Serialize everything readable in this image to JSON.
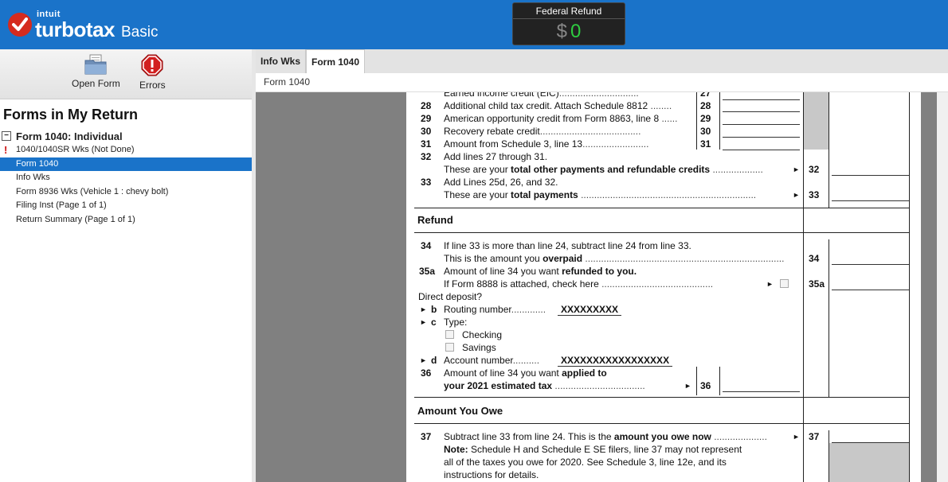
{
  "header": {
    "brand_small": "intuit",
    "brand": "turbotax",
    "edition": "Basic",
    "refund_label": "Federal Refund",
    "refund_currency": "$",
    "refund_value": "0"
  },
  "toolbar": {
    "open_form": "Open Form",
    "errors": "Errors"
  },
  "sidebar": {
    "title": "Forms in My Return",
    "root": "Form 1040:  Individual",
    "items": [
      {
        "label": "1040/1040SR Wks (Not Done)",
        "warn": "!"
      },
      {
        "label": "Form 1040"
      },
      {
        "label": "Info Wks"
      },
      {
        "label": "Form 8936 Wks (Vehicle 1 : chevy bolt)"
      },
      {
        "label": "Filing Inst (Page 1 of 1)"
      },
      {
        "label": "Return Summary (Page 1 of 1)"
      }
    ]
  },
  "tabs": [
    "Info Wks",
    "Form 1040"
  ],
  "breadcrumb": "Form 1040",
  "form": {
    "l27": {
      "text": "Earned income credit (EIC)",
      "box": "27"
    },
    "l28": {
      "num": "28",
      "text": "Additional child tax credit. Attach Schedule 8812",
      "box": "28"
    },
    "l29": {
      "num": "29",
      "text": "American opportunity credit from Form 8863, line 8",
      "box": "29"
    },
    "l30": {
      "num": "30",
      "text": "Recovery rebate credit",
      "box": "30"
    },
    "l31": {
      "num": "31",
      "text": "Amount from Schedule 3, line 13",
      "box": "31"
    },
    "l32": {
      "num": "32",
      "text1": "Add lines 27 through 31.",
      "text2a": "These are your ",
      "text2b": "total other payments and refundable credits",
      "box": "32"
    },
    "l33": {
      "num": "33",
      "text1": "Add Lines 25d, 26, and 32.",
      "text2a": "These are your ",
      "text2b": "total payments",
      "box": "33"
    },
    "refund_title": "Refund",
    "l34": {
      "num": "34",
      "text1": "If line 33 is more than line 24, subtract line 24 from line 33.",
      "text2a": "This is the amount you ",
      "text2b": "overpaid",
      "box": "34"
    },
    "l35a": {
      "num": "35a",
      "text1a": "Amount of line 34 you want ",
      "text1b": "refunded to you.",
      "text2": "If Form 8888 is attached, check here",
      "box": "35a"
    },
    "direct_deposit": "Direct deposit?",
    "lb": {
      "letter": "b",
      "text": "Routing number",
      "value": "XXXXXXXXX"
    },
    "lc": {
      "letter": "c",
      "text": "Type:",
      "opt1": "Checking",
      "opt2": "Savings"
    },
    "ld": {
      "letter": "d",
      "text": "Account number",
      "value": "XXXXXXXXXXXXXXXXX"
    },
    "l36": {
      "num": "36",
      "text1a": "Amount of line 34 you want ",
      "text1b": "applied to",
      "text2": "your 2021 estimated tax",
      "box": "36"
    },
    "owe_title": "Amount You Owe",
    "l37": {
      "num": "37",
      "text1a": "Subtract line 33 from line 24. This is the ",
      "text1b": "amount you owe now",
      "note_label": "Note:",
      "note1": " Schedule H and Schedule E SE filers, line 37 may not represent",
      "note2": "all of the taxes you owe for 2020. See Schedule 3, line 12e, and its",
      "note3": "instructions for details.",
      "box": "37"
    }
  }
}
